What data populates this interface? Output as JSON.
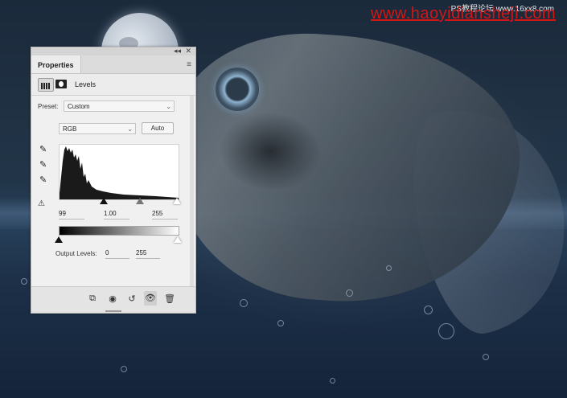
{
  "watermark": {
    "main": "www.haoyidianshejì.com",
    "sub": "PS教程论坛 www.16xx8.com"
  },
  "panel": {
    "tab": "Properties",
    "title": "Levels",
    "preset_label": "Preset:",
    "preset_value": "Custom",
    "channel_value": "RGB",
    "auto_label": "Auto",
    "input_levels": {
      "black": "99",
      "mid": "1.00",
      "white": "255"
    },
    "output_label": "Output Levels:",
    "output_levels": {
      "black": "0",
      "white": "255"
    }
  },
  "icons": {
    "collapse": "double-chevron-left-icon",
    "close": "close-icon",
    "menu": "panel-menu-icon",
    "droppers": [
      "black-point-dropper-icon",
      "gray-point-dropper-icon",
      "white-point-dropper-icon"
    ],
    "footer": [
      "clip-to-layer-icon",
      "view-previous-icon",
      "reset-icon",
      "visibility-icon",
      "trash-icon"
    ]
  }
}
